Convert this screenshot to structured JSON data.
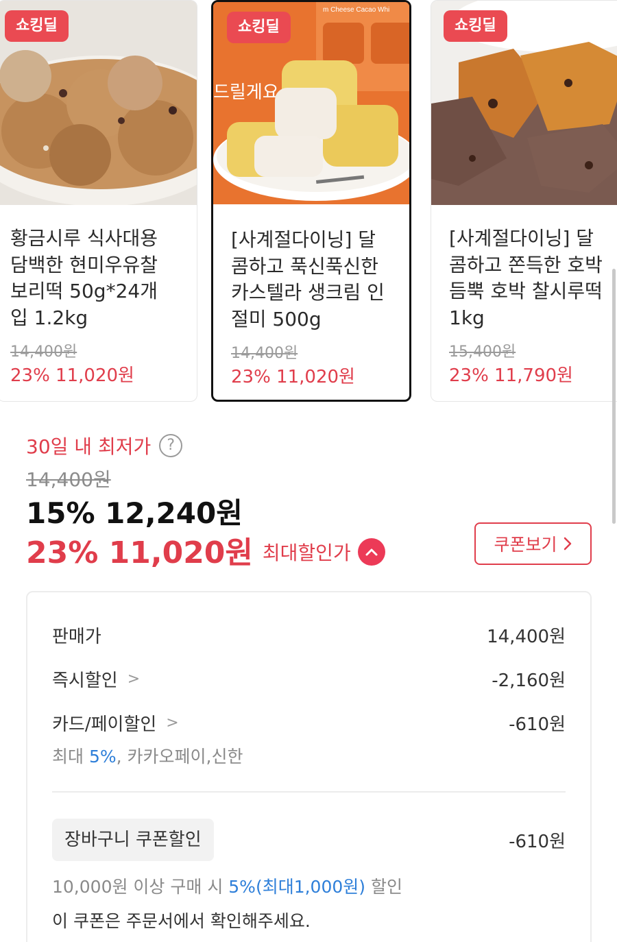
{
  "products": [
    {
      "badge": "쇼킹딜",
      "title": "황금시루 식사대용 담백한 현미우유찰 보리떡 50g*24개입 1.2kg",
      "title_lines": [
        "황금시루 식사대용",
        "담백한 현미우유찰",
        "보리떡 50g*24개",
        "입 1.2kg"
      ],
      "original_price": "14,400원",
      "sale_price": "23% 11,020원"
    },
    {
      "badge": "쇼킹딜",
      "title": "[사계절다이닝] 달콤하고 푹신푹신한 카스텔라 생크림 인절미 500g",
      "title_lines": [
        "[사계절다이닝] 달",
        "콤하고 푹신푹신한",
        "카스텔라 생크림 인",
        "절미 500g"
      ],
      "original_price": "14,400원",
      "sale_price": "23% 11,020원"
    },
    {
      "badge": "쇼킹딜",
      "title": "[사계절다이닝] 달콤하고 쫀득한 호박 듬뿍 호박 찰시루떡 1kg",
      "title_lines": [
        "[사계절다이닝] 달",
        "콤하고 쫀득한 호박",
        "듬뿍 호박 찰시루떡",
        "1kg"
      ],
      "original_price": "15,400원",
      "sale_price": "23% 11,790원"
    }
  ],
  "price": {
    "lowest_label": "30일 내 최저가",
    "help_icon": "question-circle-icon",
    "original": "14,400원",
    "instant": "15% 12,240원",
    "max_discount": "23% 11,020원",
    "max_discount_label": "최대할인가",
    "collapse_icon": "chevron-up-circle-icon",
    "coupon_button": "쿠폰보기"
  },
  "breakdown": {
    "sale_price_label": "판매가",
    "sale_price_value": "14,400원",
    "instant_label": "즉시할인",
    "instant_value": "-2,160원",
    "card_label": "카드/페이할인",
    "card_value": "-610원",
    "card_note_prefix": "최대",
    "card_note_rate": "5%",
    "card_note_suffix": ", 카카오페이,신한",
    "cart_coupon_label": "장바구니 쿠폰할인",
    "cart_coupon_value": "-610원",
    "cart_note_prefix": "10,000원 이상 구매 시",
    "cart_note_rate": "5%(최대1,000원)",
    "cart_note_suffix": "할인",
    "cart_note_2": "이 쿠폰은 주문서에서 확인해주세요."
  },
  "colors": {
    "accent": "#e03d4b",
    "badge": "#ea4a52",
    "link_blue": "#2e7fd9"
  }
}
